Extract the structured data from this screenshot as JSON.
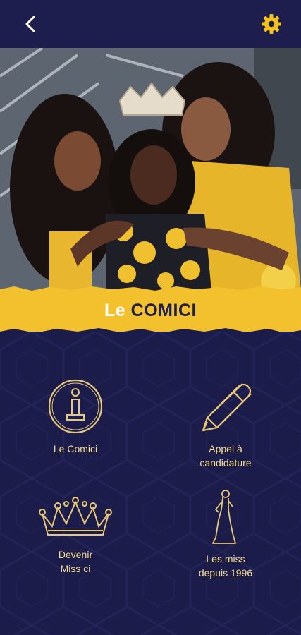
{
  "header": {
    "back_icon": "chevron-left-icon",
    "settings_icon": "gear-icon",
    "settings_color": "#f5c21a"
  },
  "banner": {
    "prefix": "Le",
    "title": "COMICI",
    "color": "#f4c12e"
  },
  "menu": [
    {
      "label": "Le Comici",
      "icon": "info-icon"
    },
    {
      "label": "Appel à\ncandidature",
      "icon": "pencil-icon"
    },
    {
      "label": "Devenir\nMiss ci",
      "icon": "crown-icon"
    },
    {
      "label": "Les miss\ndepuis 1996",
      "icon": "miss-silhouette-icon"
    }
  ],
  "colors": {
    "navy": "#1e1e4e",
    "gold": "#f0d27a",
    "yellow": "#f4c12e"
  }
}
